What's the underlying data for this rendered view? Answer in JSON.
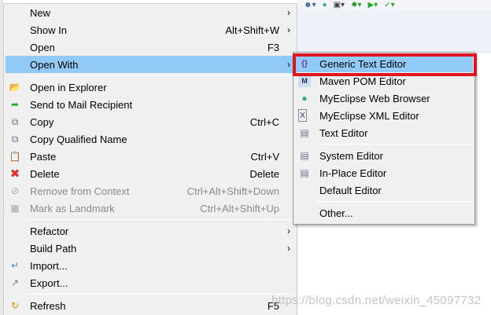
{
  "context_menu": {
    "items": [
      {
        "label": "New",
        "shortcut": "",
        "submenu": true,
        "icon": ""
      },
      {
        "label": "Show In",
        "shortcut": "Alt+Shift+W",
        "submenu": true,
        "icon": ""
      },
      {
        "label": "Open",
        "shortcut": "F3",
        "submenu": false,
        "icon": ""
      },
      {
        "label": "Open With",
        "shortcut": "",
        "submenu": true,
        "icon": "",
        "highlighted": true
      },
      {
        "label": "Open in Explorer",
        "shortcut": "",
        "icon": "folder-icon"
      },
      {
        "label": "Send to Mail Recipient",
        "shortcut": "",
        "icon": "mail-send-icon"
      },
      {
        "label": "Copy",
        "shortcut": "Ctrl+C",
        "icon": "copy-icon"
      },
      {
        "label": "Copy Qualified Name",
        "shortcut": "",
        "icon": "copy-qualified-icon"
      },
      {
        "label": "Paste",
        "shortcut": "Ctrl+V",
        "icon": "paste-icon"
      },
      {
        "label": "Delete",
        "shortcut": "Delete",
        "icon": "delete-icon"
      },
      {
        "label": "Remove from Context",
        "shortcut": "Ctrl+Alt+Shift+Down",
        "icon": "remove-context-icon",
        "disabled": true
      },
      {
        "label": "Mark as Landmark",
        "shortcut": "Ctrl+Alt+Shift+Up",
        "icon": "landmark-icon",
        "disabled": true
      },
      {
        "label": "Refactor",
        "shortcut": "",
        "submenu": true,
        "icon": ""
      },
      {
        "label": "Build Path",
        "shortcut": "",
        "submenu": true,
        "icon": ""
      },
      {
        "label": "Import...",
        "shortcut": "",
        "icon": "import-icon"
      },
      {
        "label": "Export...",
        "shortcut": "",
        "icon": "export-icon"
      },
      {
        "label": "Refresh",
        "shortcut": "F5",
        "icon": "refresh-icon"
      }
    ]
  },
  "open_with_submenu": {
    "items": [
      {
        "label": "Generic Text Editor",
        "icon": "generic-editor-icon",
        "highlighted": true
      },
      {
        "label": "Maven POM Editor",
        "icon": "maven-icon"
      },
      {
        "label": "MyEclipse Web Browser",
        "icon": "globe-icon"
      },
      {
        "label": "MyEclipse XML Editor",
        "icon": "xml-icon"
      },
      {
        "label": "Text Editor",
        "icon": "text-file-icon"
      },
      {
        "label": "System Editor",
        "icon": "text-file-icon"
      },
      {
        "label": "In-Place Editor",
        "icon": "text-file-icon"
      },
      {
        "label": "Default Editor",
        "icon": ""
      },
      {
        "label": "Other...",
        "icon": ""
      }
    ]
  },
  "watermark": "https://blog.csdn.net/weixin_45097732",
  "colors": {
    "highlight": "#91c9f7",
    "annotation": "#e0141e"
  }
}
